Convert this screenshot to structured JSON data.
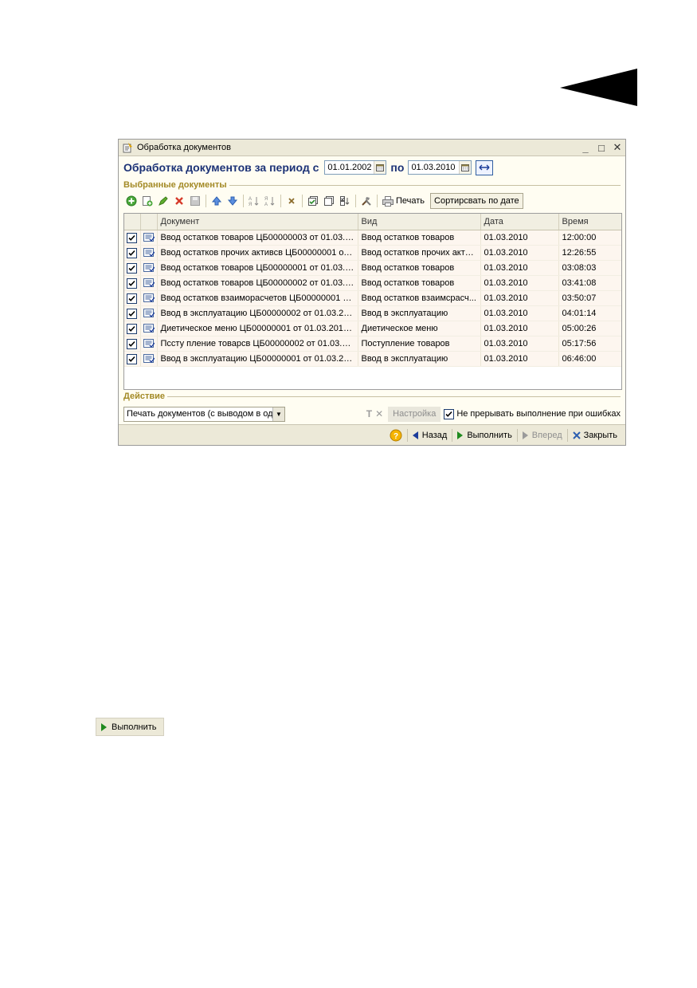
{
  "window": {
    "title": "Обработка документов",
    "controls": {
      "minimize": "_",
      "maximize": "□",
      "close": "✕"
    }
  },
  "period": {
    "label": "Обработка документов за период с",
    "to_label": "по",
    "date_from": "01.01.2002",
    "date_to": "01.03.2010"
  },
  "selected_section": {
    "title": "Выбранные документы"
  },
  "toolbar": {
    "print_label": "Печать",
    "sort_label": "Сортирсвать по дате"
  },
  "grid": {
    "columns": [
      "Документ",
      "Вид",
      "Дата",
      "Время"
    ],
    "rows": [
      {
        "document": "Ввод остатков товаров ЦБ00000003 от 01.03.2...",
        "kind": "Ввод остатков товаров",
        "date": "01.03.2010",
        "time": "12:00:00"
      },
      {
        "document": "Ввод остатков прочих активсв ЦБ00000001 от ...",
        "kind": "Ввод остатков прочих акти...",
        "date": "01.03.2010",
        "time": "12:26:55"
      },
      {
        "document": "Ввод остатков товаров ЦБ00000001 от 01.03.2...",
        "kind": "Ввод остатков товаров",
        "date": "01.03.2010",
        "time": "03:08:03"
      },
      {
        "document": "Ввод остатков товаров ЦБ00000002 от 01.03.2...",
        "kind": "Ввод остатков товаров",
        "date": "01.03.2010",
        "time": "03:41:08"
      },
      {
        "document": "Ввод остатков взаиморасчетов ЦБ00000001 о...",
        "kind": "Ввод остатков взаимсрасч...",
        "date": "01.03.2010",
        "time": "03:50:07"
      },
      {
        "document": "Ввод в эксплуатацию ЦБ00000002 от 01.03.20...",
        "kind": "Ввод в эксплуатацию",
        "date": "01.03.2010",
        "time": "04:01:14"
      },
      {
        "document": "Диетическое меню ЦБ00000001 от 01.03.2010 ...",
        "kind": "Диетическое меню",
        "date": "01.03.2010",
        "time": "05:00:26"
      },
      {
        "document": "Пссту пление товарсв ЦБ00000002 от 01.03.20...",
        "kind": "Поступление товаров",
        "date": "01.03.2010",
        "time": "05:17:56"
      },
      {
        "document": "Ввод в эксплуатацию ЦБ00000001 от 01.03.20 ...",
        "kind": "Ввод в эксплуатацию",
        "date": "01.03.2010",
        "time": "06:46:00"
      }
    ]
  },
  "action_section": {
    "title": "Действие",
    "select_value": "Печать документов (с выводом в одн",
    "setup_label": "Настройка",
    "continue_label": "Не прерывать выполнение при ошибках"
  },
  "bottombar": {
    "back_label": "Назад",
    "run_label": "Выполнить",
    "forward_label": "Вперед",
    "close_label": "Закрыть"
  },
  "standalone_button": {
    "label": "Выполнить"
  },
  "colors": {
    "title_blue": "#1c3276",
    "section_gold": "#a38a26",
    "run_green": "#1f8a1f",
    "nav_blue": "#1c3c9a"
  }
}
